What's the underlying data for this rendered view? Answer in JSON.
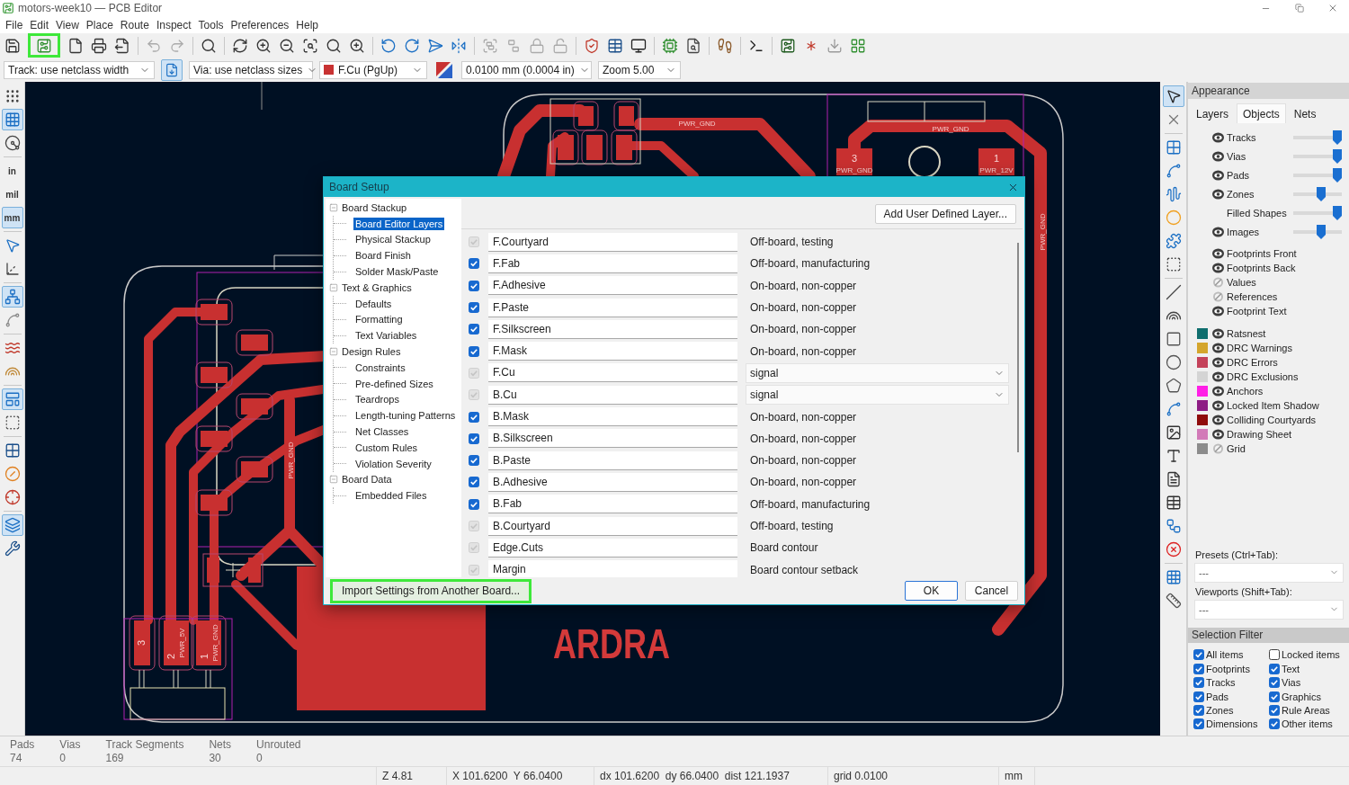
{
  "window": {
    "title": "motors-week10 — PCB Editor"
  },
  "menu": [
    "File",
    "Edit",
    "View",
    "Place",
    "Route",
    "Inspect",
    "Tools",
    "Preferences",
    "Help"
  ],
  "main_toolbar": {
    "setup_button": {
      "highlighted": true
    }
  },
  "options_toolbar": {
    "track_width": "Track: use netclass width",
    "auto_width": {
      "selected": true
    },
    "via_size": "Via: use netclass sizes",
    "layer": {
      "label": "F.Cu (PgUp)",
      "color": "#c83232"
    },
    "grid": "0.0100 mm (0.0004 in)",
    "zoom": "Zoom 5.00"
  },
  "left_toolbar": [
    {
      "selected": false
    },
    {
      "selected": true
    },
    {
      "selected": false
    },
    {
      "label": "in",
      "selected": false
    },
    {
      "label": "mil",
      "selected": false
    },
    {
      "label": "mm",
      "selected": true
    },
    {
      "selected": false
    },
    {
      "selected": false
    },
    {
      "selected": true
    },
    {
      "selected": false
    },
    {
      "selected": false
    },
    {
      "selected": false
    },
    {
      "selected": true
    },
    {
      "selected": false
    },
    {
      "selected": false
    },
    {
      "selected": false
    },
    {
      "selected": false
    },
    {
      "selected": true
    },
    {
      "selected": false
    }
  ],
  "canvas": {
    "labels": [
      {
        "text": "PWR_GND",
        "kind": "net"
      },
      {
        "text": "PWR_GND",
        "kind": "net"
      },
      {
        "text": "3",
        "kind": "pad"
      },
      {
        "text": "PWR_GND",
        "kind": "net"
      },
      {
        "text": "1",
        "kind": "pad"
      },
      {
        "text": "PWR_12V",
        "kind": "net"
      },
      {
        "text": "PWR_GND",
        "kind": "net"
      },
      {
        "text": "PWR_GND",
        "kind": "net"
      },
      {
        "text": "ARDRA",
        "kind": "logo"
      },
      {
        "text": "3",
        "kind": "pad"
      },
      {
        "text": "2",
        "kind": "pad"
      },
      {
        "text": "PWR_5V",
        "kind": "net"
      },
      {
        "text": "1",
        "kind": "pad"
      },
      {
        "text": "PWR_GND",
        "kind": "net"
      }
    ]
  },
  "right_toolbar": [
    {
      "selected": true
    },
    {
      "selected": false
    },
    {
      "selected": false
    },
    {
      "selected": false
    },
    {
      "selected": false
    },
    {
      "selected": false
    },
    {
      "selected": false
    },
    {
      "selected": false
    },
    {
      "selected": false
    },
    {
      "selected": false
    },
    {
      "selected": false
    },
    {
      "selected": false
    },
    {
      "selected": false
    },
    {
      "selected": false
    },
    {
      "selected": false
    },
    {
      "selected": false
    },
    {
      "selected": false
    },
    {
      "selected": false
    },
    {
      "selected": false
    },
    {
      "selected": false
    },
    {
      "selected": false
    },
    {
      "selected": false
    }
  ],
  "appearance": {
    "title": "Appearance",
    "tabs": [
      {
        "label": "Layers",
        "selected": false
      },
      {
        "label": "Objects",
        "selected": true
      },
      {
        "label": "Nets",
        "selected": false
      }
    ],
    "objects": [
      {
        "kind": "opacity",
        "label": "Tracks",
        "visible": true,
        "level": 1
      },
      {
        "kind": "opacity",
        "label": "Vias",
        "visible": true,
        "level": 1
      },
      {
        "kind": "opacity",
        "label": "Pads",
        "visible": true,
        "level": 1
      },
      {
        "kind": "opacity",
        "label": "Zones",
        "visible": true,
        "level": 0.6
      },
      {
        "kind": "opacity",
        "label": "Filled Shapes",
        "level": 1
      },
      {
        "kind": "opacity",
        "label": "Images",
        "visible": true,
        "level": 0.6
      },
      {
        "kind": "toggle",
        "label": "Footprints Front",
        "visible": true
      },
      {
        "kind": "toggle",
        "label": "Footprints Back",
        "visible": true
      },
      {
        "kind": "toggle",
        "label": "Values",
        "visible": false
      },
      {
        "kind": "toggle",
        "label": "References",
        "visible": false
      },
      {
        "kind": "toggle",
        "label": "Footprint Text",
        "visible": true
      },
      {
        "kind": "color",
        "label": "Ratsnest",
        "color": "#0f6e6e",
        "visible": true
      },
      {
        "kind": "color",
        "label": "DRC Warnings",
        "color": "#d4a52c",
        "visible": true
      },
      {
        "kind": "color",
        "label": "DRC Errors",
        "color": "#c4425a",
        "visible": true
      },
      {
        "kind": "color",
        "label": "DRC Exclusions",
        "color": "#d4d4d4",
        "visible": true
      },
      {
        "kind": "color",
        "label": "Anchors",
        "color": "#ff1fe6",
        "visible": true
      },
      {
        "kind": "color",
        "label": "Locked Item Shadow",
        "color": "#8e1d84",
        "visible": true
      },
      {
        "kind": "color",
        "label": "Colliding Courtyards",
        "color": "#8f0b0b",
        "visible": true
      },
      {
        "kind": "color",
        "label": "Drawing Sheet",
        "color": "#d27ab8",
        "visible": true
      },
      {
        "kind": "color",
        "label": "Grid",
        "color": "#8c8c8c",
        "visible": false
      }
    ],
    "presets_label": "Presets (Ctrl+Tab):",
    "presets_value": "---",
    "viewports_label": "Viewports (Shift+Tab):",
    "viewports_value": "---"
  },
  "selection_filter": {
    "title": "Selection Filter",
    "items": [
      {
        "label": "All items",
        "checked": true
      },
      {
        "label": "Locked items",
        "checked": false
      },
      {
        "label": "Footprints",
        "checked": true
      },
      {
        "label": "Text",
        "checked": true
      },
      {
        "label": "Tracks",
        "checked": true
      },
      {
        "label": "Vias",
        "checked": true
      },
      {
        "label": "Pads",
        "checked": true
      },
      {
        "label": "Graphics",
        "checked": true
      },
      {
        "label": "Zones",
        "checked": true
      },
      {
        "label": "Rule Areas",
        "checked": true
      },
      {
        "label": "Dimensions",
        "checked": true
      },
      {
        "label": "Other items",
        "checked": true
      }
    ]
  },
  "message_panel": [
    {
      "label": "Pads",
      "value": "74"
    },
    {
      "label": "Vias",
      "value": "0"
    },
    {
      "label": "Track Segments",
      "value": "169"
    },
    {
      "label": "Nets",
      "value": "30"
    },
    {
      "label": "Unrouted",
      "value": "0"
    }
  ],
  "status_bar": [
    "Z 4.81",
    "X 101.6200  Y 66.0400",
    "dx 101.6200  dy 66.0400  dist 121.1937",
    "grid 0.0100",
    "mm"
  ],
  "dialog": {
    "title": "Board Setup",
    "tree": [
      {
        "label": "Board Stackup",
        "expanded": true,
        "selected": false,
        "children": [
          {
            "label": "Board Editor Layers",
            "selected": true
          },
          {
            "label": "Physical Stackup",
            "selected": false
          },
          {
            "label": "Board Finish",
            "selected": false
          },
          {
            "label": "Solder Mask/Paste",
            "selected": false
          }
        ]
      },
      {
        "label": "Text & Graphics",
        "expanded": true,
        "selected": false,
        "children": [
          {
            "label": "Defaults",
            "selected": false
          },
          {
            "label": "Formatting",
            "selected": false
          },
          {
            "label": "Text Variables",
            "selected": false
          }
        ]
      },
      {
        "label": "Design Rules",
        "expanded": true,
        "selected": false,
        "children": [
          {
            "label": "Constraints",
            "selected": false
          },
          {
            "label": "Pre-defined Sizes",
            "selected": false
          },
          {
            "label": "Teardrops",
            "selected": false
          },
          {
            "label": "Length-tuning Patterns",
            "selected": false
          },
          {
            "label": "Net Classes",
            "selected": false
          },
          {
            "label": "Custom Rules",
            "selected": false
          },
          {
            "label": "Violation Severity",
            "selected": false
          }
        ]
      },
      {
        "label": "Board Data",
        "expanded": true,
        "selected": false,
        "children": [
          {
            "label": "Embedded Files",
            "selected": false
          }
        ]
      }
    ],
    "add_layer_button": "Add User Defined Layer...",
    "layers": [
      {
        "name": "F.Courtyard",
        "checked": true,
        "disabled": true,
        "kind": "text",
        "type": "Off-board, testing"
      },
      {
        "name": "F.Fab",
        "checked": true,
        "disabled": false,
        "kind": "text",
        "type": "Off-board, manufacturing"
      },
      {
        "name": "F.Adhesive",
        "checked": true,
        "disabled": false,
        "kind": "text",
        "type": "On-board, non-copper"
      },
      {
        "name": "F.Paste",
        "checked": true,
        "disabled": false,
        "kind": "text",
        "type": "On-board, non-copper"
      },
      {
        "name": "F.Silkscreen",
        "checked": true,
        "disabled": false,
        "kind": "text",
        "type": "On-board, non-copper"
      },
      {
        "name": "F.Mask",
        "checked": true,
        "disabled": false,
        "kind": "text",
        "type": "On-board, non-copper"
      },
      {
        "name": "F.Cu",
        "checked": true,
        "disabled": true,
        "kind": "dropdown",
        "type": "signal"
      },
      {
        "name": "B.Cu",
        "checked": true,
        "disabled": true,
        "kind": "dropdown",
        "type": "signal"
      },
      {
        "name": "B.Mask",
        "checked": true,
        "disabled": false,
        "kind": "text",
        "type": "On-board, non-copper"
      },
      {
        "name": "B.Silkscreen",
        "checked": true,
        "disabled": false,
        "kind": "text",
        "type": "On-board, non-copper"
      },
      {
        "name": "B.Paste",
        "checked": true,
        "disabled": false,
        "kind": "text",
        "type": "On-board, non-copper"
      },
      {
        "name": "B.Adhesive",
        "checked": true,
        "disabled": false,
        "kind": "text",
        "type": "On-board, non-copper"
      },
      {
        "name": "B.Fab",
        "checked": true,
        "disabled": false,
        "kind": "text",
        "type": "Off-board, manufacturing"
      },
      {
        "name": "B.Courtyard",
        "checked": true,
        "disabled": true,
        "kind": "text",
        "type": "Off-board, testing"
      },
      {
        "name": "Edge.Cuts",
        "checked": true,
        "disabled": true,
        "kind": "text",
        "type": "Board contour"
      },
      {
        "name": "Margin",
        "checked": true,
        "disabled": true,
        "kind": "text",
        "type": "Board contour setback"
      }
    ],
    "import_button": {
      "label": "Import Settings from Another Board...",
      "highlighted": true
    },
    "ok_button": "OK",
    "cancel_button": "Cancel"
  }
}
